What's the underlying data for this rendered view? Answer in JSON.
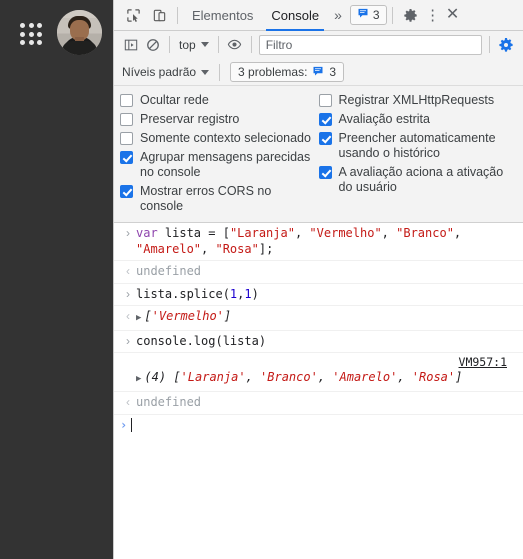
{
  "browser_strip": {
    "apps_icon": "apps-grid-icon",
    "avatar": "user-avatar"
  },
  "devtools": {
    "tabbar": {
      "inspect_icon": "inspect-element-icon",
      "device_icon": "device-toolbar-icon",
      "tabs": [
        {
          "label": "Elementos",
          "active": false
        },
        {
          "label": "Console",
          "active": true
        }
      ],
      "more_tabs_label": "»",
      "issues_count": "3",
      "issues_icon": "message-icon",
      "settings_icon": "gear-icon",
      "more_options_icon": "kebab-menu-icon",
      "close_icon": "close-icon"
    },
    "console_toolbar": {
      "sidebar_icon": "console-sidebar-icon",
      "clear_icon": "clear-console-icon",
      "context_value": "top",
      "eye_icon": "live-expression-eye-icon",
      "filter_value": "",
      "filter_placeholder": "Filtro",
      "settings_icon": "gear-icon"
    },
    "levels_row": {
      "levels_value": "Níveis padrão",
      "problems_label": "3 problemas:",
      "problems_icon": "message-icon",
      "problems_count": "3"
    },
    "settings_pane": {
      "left": [
        {
          "label": "Ocultar rede",
          "checked": false
        },
        {
          "label": "Preservar registro",
          "checked": false
        },
        {
          "label": "Somente contexto selecionado",
          "checked": false
        },
        {
          "label": "Agrupar mensagens parecidas no console",
          "checked": true
        },
        {
          "label": "Mostrar erros CORS no console",
          "checked": true
        }
      ],
      "right": [
        {
          "label": "Registrar XMLHttpRequests",
          "checked": false
        },
        {
          "label": "Avaliação estrita",
          "checked": true
        },
        {
          "label": "Preencher automaticamente usando o histórico",
          "checked": true
        },
        {
          "label": "A avaliação aciona a ativação do usuário",
          "checked": true
        }
      ]
    },
    "console": {
      "entry1_input": "var lista = [\"Laranja\", \"Vermelho\", \"Branco\", \"Amarelo\", \"Rosa\"];",
      "entry1_output": "undefined",
      "entry2_input": "lista.splice(1,1)",
      "entry2_output": "['Vermelho']",
      "entry3_input": "console.log(lista)",
      "entry3_source": "VM957:1",
      "entry3_log": "(4) ['Laranja', 'Branco', 'Amarelo', 'Rosa']",
      "entry3_output": "undefined",
      "prompt_value": ""
    }
  },
  "colors": {
    "accent": "#1a73e8",
    "strip_bg": "#333333",
    "toolbar_bg": "#f3f3f3",
    "string": "#c41a16",
    "keyword": "#8e44ad",
    "number": "#1c00cf",
    "muted": "#9aa0a6"
  }
}
